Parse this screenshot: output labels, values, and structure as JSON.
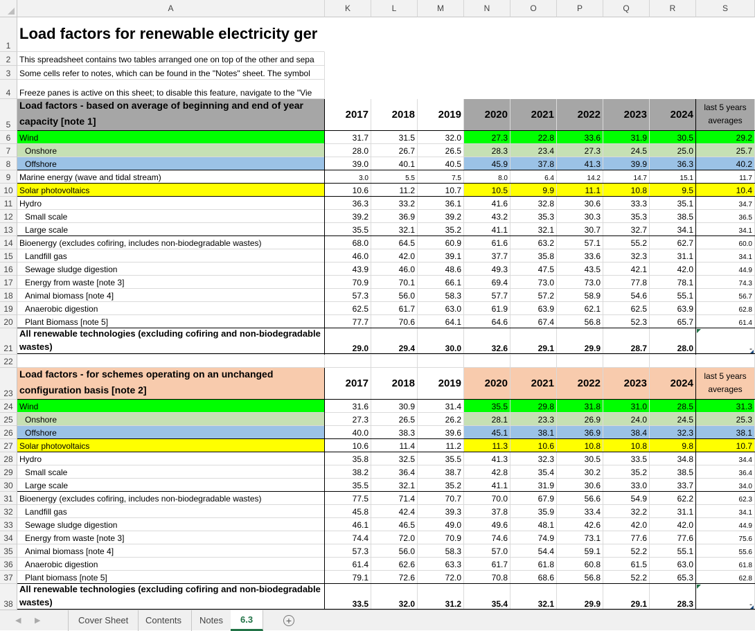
{
  "columns": [
    "A",
    "K",
    "L",
    "M",
    "N",
    "O",
    "P",
    "Q",
    "R",
    "S"
  ],
  "title": "Load factors for renewable electricity ger",
  "notes": [
    "This spreadsheet contains two tables arranged one on top of the other and sepa",
    "Some cells refer to notes, which can be found in the \"Notes\" sheet. The symbol",
    "Freeze panes is active on this sheet; to disable this feature, navigate to the \"Vie"
  ],
  "years": [
    "2017",
    "2018",
    "2019",
    "2020",
    "2021",
    "2022",
    "2023",
    "2024"
  ],
  "avg_label": "last 5 years averages",
  "colors": {
    "grey_header": "#a6a6a6",
    "peach_header": "#f8cbad",
    "wind": "#00ff00",
    "onshore": "#c6e0b4",
    "offshore": "#9bc2e6",
    "solar": "#ffff00"
  },
  "table1": {
    "header": "Load factors - based on average of beginning and end of year capacity [note 1]",
    "rows": [
      {
        "row": "6",
        "label": "Wind",
        "style": "wind",
        "indent": false,
        "values": [
          "31.7",
          "31.5",
          "32.0",
          "27.3",
          "22.8",
          "33.6",
          "31.9",
          "30.5"
        ],
        "avg": "29.2"
      },
      {
        "row": "7",
        "label": "Onshore",
        "style": "onshore",
        "indent": true,
        "values": [
          "28.0",
          "26.7",
          "26.5",
          "28.3",
          "23.4",
          "27.3",
          "24.5",
          "25.0"
        ],
        "avg": "25.7"
      },
      {
        "row": "8",
        "label": "Offshore",
        "style": "offshore",
        "indent": true,
        "values": [
          "39.0",
          "40.1",
          "40.5",
          "45.9",
          "37.8",
          "41.3",
          "39.9",
          "36.3"
        ],
        "avg": "40.2"
      },
      {
        "row": "9",
        "label": "Marine energy (wave and tidal stream)",
        "style": "small",
        "indent": false,
        "values": [
          "3.0",
          "5.5",
          "7.5",
          "8.0",
          "6.4",
          "14.2",
          "14.7",
          "15.1"
        ],
        "avg": "11.7"
      },
      {
        "row": "10",
        "label": "Solar photovoltaics",
        "style": "solar",
        "indent": false,
        "values": [
          "10.6",
          "11.2",
          "10.7",
          "10.5",
          "9.9",
          "11.1",
          "10.8",
          "9.5"
        ],
        "avg": "10.4"
      },
      {
        "row": "11",
        "label": "Hydro",
        "style": "plain",
        "indent": false,
        "values": [
          "36.3",
          "33.2",
          "36.1",
          "41.6",
          "32.8",
          "30.6",
          "33.3",
          "35.1"
        ],
        "avg": "34.7"
      },
      {
        "row": "12",
        "label": "Small scale",
        "style": "plain",
        "indent": true,
        "values": [
          "39.2",
          "36.9",
          "39.2",
          "43.2",
          "35.3",
          "30.3",
          "35.3",
          "38.5"
        ],
        "avg": "36.5"
      },
      {
        "row": "13",
        "label": "Large scale",
        "style": "plain",
        "indent": true,
        "values": [
          "35.5",
          "32.1",
          "35.2",
          "41.1",
          "32.1",
          "30.7",
          "32.7",
          "34.1"
        ],
        "avg": "34.1"
      },
      {
        "row": "14",
        "label": "Bioenergy (excludes cofiring, includes non-biodegradable wastes)",
        "style": "plain",
        "indent": false,
        "values": [
          "68.0",
          "64.5",
          "60.9",
          "61.6",
          "63.2",
          "57.1",
          "55.2",
          "62.7"
        ],
        "avg": "60.0"
      },
      {
        "row": "15",
        "label": "Landfill gas",
        "style": "plain",
        "indent": true,
        "values": [
          "46.0",
          "42.0",
          "39.1",
          "37.7",
          "35.8",
          "33.6",
          "32.3",
          "31.1"
        ],
        "avg": "34.1"
      },
      {
        "row": "16",
        "label": "Sewage sludge digestion",
        "style": "plain",
        "indent": true,
        "values": [
          "43.9",
          "46.0",
          "48.6",
          "49.3",
          "47.5",
          "43.5",
          "42.1",
          "42.0"
        ],
        "avg": "44.9"
      },
      {
        "row": "17",
        "label": "Energy from waste [note 3]",
        "style": "plain",
        "indent": true,
        "values": [
          "70.9",
          "70.1",
          "66.1",
          "69.4",
          "73.0",
          "73.0",
          "77.8",
          "78.1"
        ],
        "avg": "74.3"
      },
      {
        "row": "18",
        "label": "Animal biomass [note 4]",
        "style": "plain",
        "indent": true,
        "values": [
          "57.3",
          "56.0",
          "58.3",
          "57.7",
          "57.2",
          "58.9",
          "54.6",
          "55.1"
        ],
        "avg": "56.7"
      },
      {
        "row": "19",
        "label": "Anaerobic digestion",
        "style": "plain",
        "indent": true,
        "values": [
          "62.5",
          "61.7",
          "63.0",
          "61.9",
          "63.9",
          "62.1",
          "62.5",
          "63.9"
        ],
        "avg": "62.8"
      },
      {
        "row": "20",
        "label": "Plant Biomass [note 5]",
        "style": "plain",
        "indent": true,
        "values": [
          "77.7",
          "70.6",
          "64.1",
          "64.6",
          "67.4",
          "56.8",
          "52.3",
          "65.7"
        ],
        "avg": "61.4"
      }
    ],
    "total": {
      "row": "21",
      "label": "All renewable technologies (excluding cofiring and non-biodegradable wastes)",
      "values": [
        "29.0",
        "29.4",
        "30.0",
        "32.6",
        "29.1",
        "29.9",
        "28.7",
        "28.0"
      ],
      "avg": "-"
    }
  },
  "table2": {
    "header": "Load factors - for schemes operating on an unchanged configuration basis [note 2]",
    "rows": [
      {
        "row": "24",
        "label": "Wind",
        "style": "wind",
        "indent": false,
        "values": [
          "31.6",
          "30.9",
          "31.4",
          "35.5",
          "29.8",
          "31.8",
          "31.0",
          "28.5"
        ],
        "avg": "31.3"
      },
      {
        "row": "25",
        "label": "Onshore",
        "style": "onshore",
        "indent": true,
        "values": [
          "27.3",
          "26.5",
          "26.2",
          "28.1",
          "23.3",
          "26.9",
          "24.0",
          "24.5"
        ],
        "avg": "25.3"
      },
      {
        "row": "26",
        "label": "Offshore",
        "style": "offshore",
        "indent": true,
        "values": [
          "40.0",
          "38.3",
          "39.6",
          "45.1",
          "38.1",
          "36.9",
          "38.4",
          "32.3"
        ],
        "avg": "38.1"
      },
      {
        "row": "27",
        "label": "Solar photovoltaics",
        "style": "solar",
        "indent": false,
        "values": [
          "10.6",
          "11.4",
          "11.2",
          "11.3",
          "10.6",
          "10.8",
          "10.8",
          "9.8"
        ],
        "avg": "10.7"
      },
      {
        "row": "28",
        "label": "Hydro",
        "style": "plain",
        "indent": false,
        "values": [
          "35.8",
          "32.5",
          "35.5",
          "41.3",
          "32.3",
          "30.5",
          "33.5",
          "34.8"
        ],
        "avg": "34.4"
      },
      {
        "row": "29",
        "label": "Small scale",
        "style": "plain",
        "indent": true,
        "values": [
          "38.2",
          "36.4",
          "38.7",
          "42.8",
          "35.4",
          "30.2",
          "35.2",
          "38.5"
        ],
        "avg": "36.4"
      },
      {
        "row": "30",
        "label": "Large scale",
        "style": "plain",
        "indent": true,
        "values": [
          "35.5",
          "32.1",
          "35.2",
          "41.1",
          "31.9",
          "30.6",
          "33.0",
          "33.7"
        ],
        "avg": "34.0"
      },
      {
        "row": "31",
        "label": "Bioenergy (excludes cofiring, includes non-biodegradable wastes)",
        "style": "plain",
        "indent": false,
        "values": [
          "77.5",
          "71.4",
          "70.7",
          "70.0",
          "67.9",
          "56.6",
          "54.9",
          "62.2"
        ],
        "avg": "62.3"
      },
      {
        "row": "32",
        "label": "Landfill gas",
        "style": "plain",
        "indent": true,
        "values": [
          "45.8",
          "42.4",
          "39.3",
          "37.8",
          "35.9",
          "33.4",
          "32.2",
          "31.1"
        ],
        "avg": "34.1"
      },
      {
        "row": "33",
        "label": "Sewage sludge digestion",
        "style": "plain",
        "indent": true,
        "values": [
          "46.1",
          "46.5",
          "49.0",
          "49.6",
          "48.1",
          "42.6",
          "42.0",
          "42.0"
        ],
        "avg": "44.9"
      },
      {
        "row": "34",
        "label": "Energy from waste [note 3]",
        "style": "plain",
        "indent": true,
        "values": [
          "74.4",
          "72.0",
          "70.9",
          "74.6",
          "74.9",
          "73.1",
          "77.6",
          "77.6"
        ],
        "avg": "75.6"
      },
      {
        "row": "35",
        "label": "Animal biomass [note 4]",
        "style": "plain",
        "indent": true,
        "values": [
          "57.3",
          "56.0",
          "58.3",
          "57.0",
          "54.4",
          "59.1",
          "52.2",
          "55.1"
        ],
        "avg": "55.6"
      },
      {
        "row": "36",
        "label": "Anaerobic digestion",
        "style": "plain",
        "indent": true,
        "values": [
          "61.4",
          "62.6",
          "63.3",
          "61.7",
          "61.8",
          "60.8",
          "61.5",
          "63.0"
        ],
        "avg": "61.8"
      },
      {
        "row": "37",
        "label": "Plant biomass [note 5]",
        "style": "plain",
        "indent": true,
        "values": [
          "79.1",
          "72.6",
          "72.0",
          "70.8",
          "68.6",
          "56.8",
          "52.2",
          "65.3"
        ],
        "avg": "62.8"
      }
    ],
    "total": {
      "row": "38",
      "label": "All renewable technologies (excluding cofiring and non-biodegradable wastes)",
      "values": [
        "33.5",
        "32.0",
        "31.2",
        "35.4",
        "32.1",
        "29.9",
        "29.1",
        "28.3"
      ],
      "avg": "-"
    }
  },
  "sheet_tabs": [
    "Cover Sheet",
    "Contents",
    "Notes",
    "6.3"
  ],
  "active_tab": "6.3",
  "nav_icons": [
    "scroll-left-icon",
    "scroll-right-icon"
  ],
  "add_sheet_icon": "plus-circle-icon"
}
